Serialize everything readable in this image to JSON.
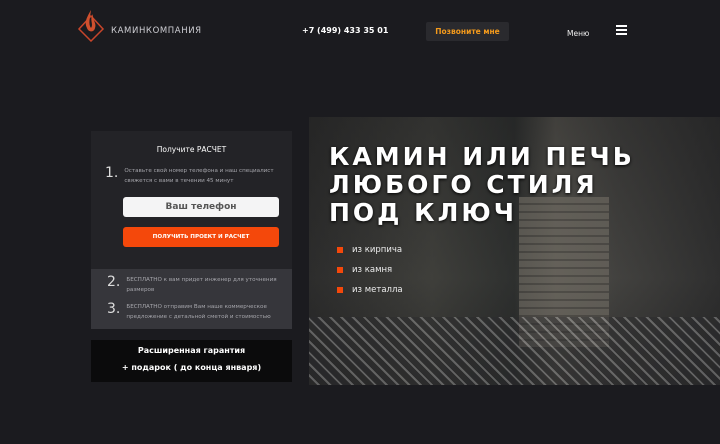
{
  "header": {
    "brand": "КАМИНКОМПАНИЯ",
    "phone": "+7 (499) 433 35 01",
    "call_button": "Позвоните мне",
    "menu": "Меню"
  },
  "form": {
    "title": "Получите РАСЧЕТ",
    "steps": [
      {
        "num": "1.",
        "text": "Оставьте свой номер телефона и наш специалист свяжется с вами в течении 45 минут"
      },
      {
        "num": "2.",
        "text": "БЕСПЛАТНО к вам придет инженер для уточнения размеров"
      },
      {
        "num": "3.",
        "text": "БЕСПЛАТНО отправим Вам наше коммерческое предложение с детальной сметой и стоимостью"
      }
    ],
    "phone_placeholder": "Ваш телефон",
    "submit": "ПОЛУЧИТЬ ПРОЕКТ И РАСЧЕТ"
  },
  "gift": {
    "line1": "Расширенная гарантия",
    "line2": "+ подарок ( до конца января)"
  },
  "hero": {
    "title_lines": [
      "КАМИН ИЛИ ПЕЧЬ",
      "ЛЮБОГО СТИЛЯ",
      "ПОД КЛЮЧ"
    ],
    "bullets": [
      "из кирпича",
      "из камня",
      "из металла"
    ]
  },
  "colors": {
    "accent": "#f4480b",
    "call": "#f39a1c"
  }
}
